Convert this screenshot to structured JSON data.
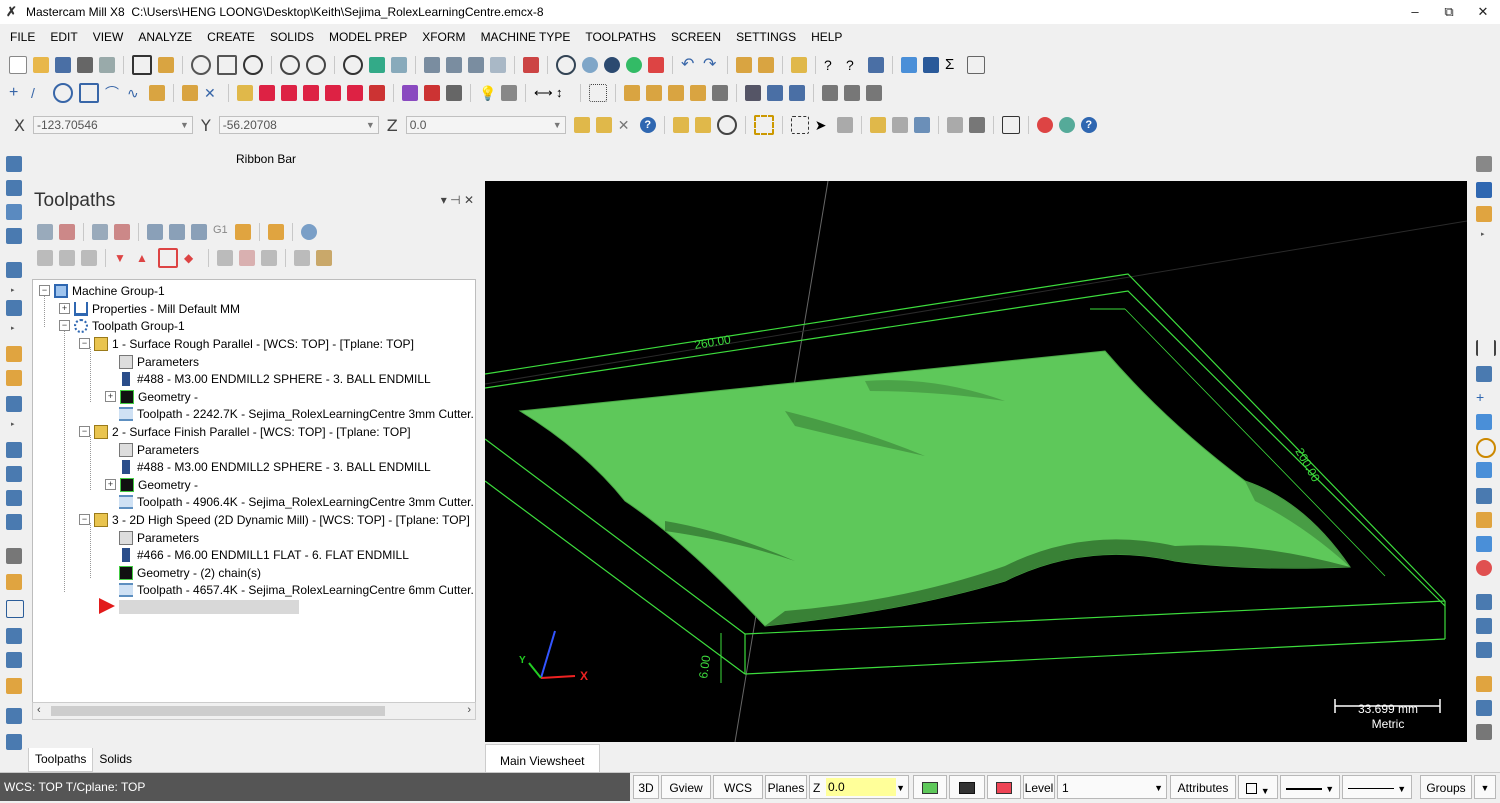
{
  "window": {
    "app_title": "Mastercam Mill X8",
    "file_path": "C:\\Users\\HENG LOONG\\Desktop\\Keith\\Sejima_RolexLearningCentre.emcx-8",
    "minimize": "–",
    "restore": "⧉",
    "close": "✕"
  },
  "menu": [
    "FILE",
    "EDIT",
    "VIEW",
    "ANALYZE",
    "CREATE",
    "SOLIDS",
    "MODEL PREP",
    "XFORM",
    "MACHINE TYPE",
    "TOOLPATHS",
    "SCREEN",
    "SETTINGS",
    "HELP"
  ],
  "coords": {
    "x_label": "X",
    "x_value": "-123.70546",
    "y_label": "Y",
    "y_value": "-56.20708",
    "z_label": "Z",
    "z_value": "0.0"
  },
  "ribbon_label": "Ribbon Bar",
  "toolpaths_panel": {
    "title": "Toolpaths",
    "pin": "▾  ⊣  ✕",
    "tree": {
      "machine_group": "Machine Group-1",
      "properties": "Properties - Mill Default MM",
      "toolpath_group": "Toolpath Group-1",
      "operations": [
        {
          "name": "1 - Surface Rough Parallel - [WCS: TOP] - [Tplane: TOP]",
          "parameters": "Parameters",
          "tool": "#488 - M3.00 ENDMILL2 SPHERE - 3. BALL ENDMILL",
          "geometry": "Geometry -",
          "toolpath": "Toolpath - 2242.7K - Sejima_RolexLearningCentre 3mm Cutter."
        },
        {
          "name": "2 - Surface Finish Parallel - [WCS: TOP] - [Tplane: TOP]",
          "parameters": "Parameters",
          "tool": "#488 - M3.00 ENDMILL2 SPHERE - 3. BALL ENDMILL",
          "geometry": "Geometry -",
          "toolpath": "Toolpath - 4906.4K - Sejima_RolexLearningCentre 3mm Cutter."
        },
        {
          "name": "3 - 2D High Speed (2D Dynamic Mill) - [WCS: TOP] - [Tplane: TOP]",
          "parameters": "Parameters",
          "tool": "#466 - M6.00 ENDMILL1 FLAT - 6. FLAT ENDMILL",
          "geometry": "Geometry - (2) chain(s)",
          "toolpath": "Toolpath - 4657.4K - Sejima_RolexLearningCentre 6mm Cutter."
        }
      ]
    },
    "tabs": [
      "Toolpaths",
      "Solids"
    ]
  },
  "viewport": {
    "dim_top": "260.00",
    "dim_right": "200.00",
    "dim_height": "6.00",
    "gnomon_x": "X",
    "gnomon_y": "Y",
    "scale_value": "33.699 mm",
    "scale_unit": "Metric",
    "colors": {
      "stock": "#3ddc3d",
      "part": "#5ec85a",
      "background": "#000000"
    }
  },
  "viewsheet_tab": "Main Viewsheet",
  "statusbar": {
    "wcs": "WCS: TOP   T/Cplane: TOP",
    "btn_3d": "3D",
    "btn_gview": "Gview",
    "btn_wcs": "WCS",
    "btn_planes": "Planes",
    "z_label": "Z",
    "z_value": "0.0",
    "level_label": "Level",
    "level_value": "1",
    "attributes": "Attributes",
    "groups": "Groups"
  }
}
